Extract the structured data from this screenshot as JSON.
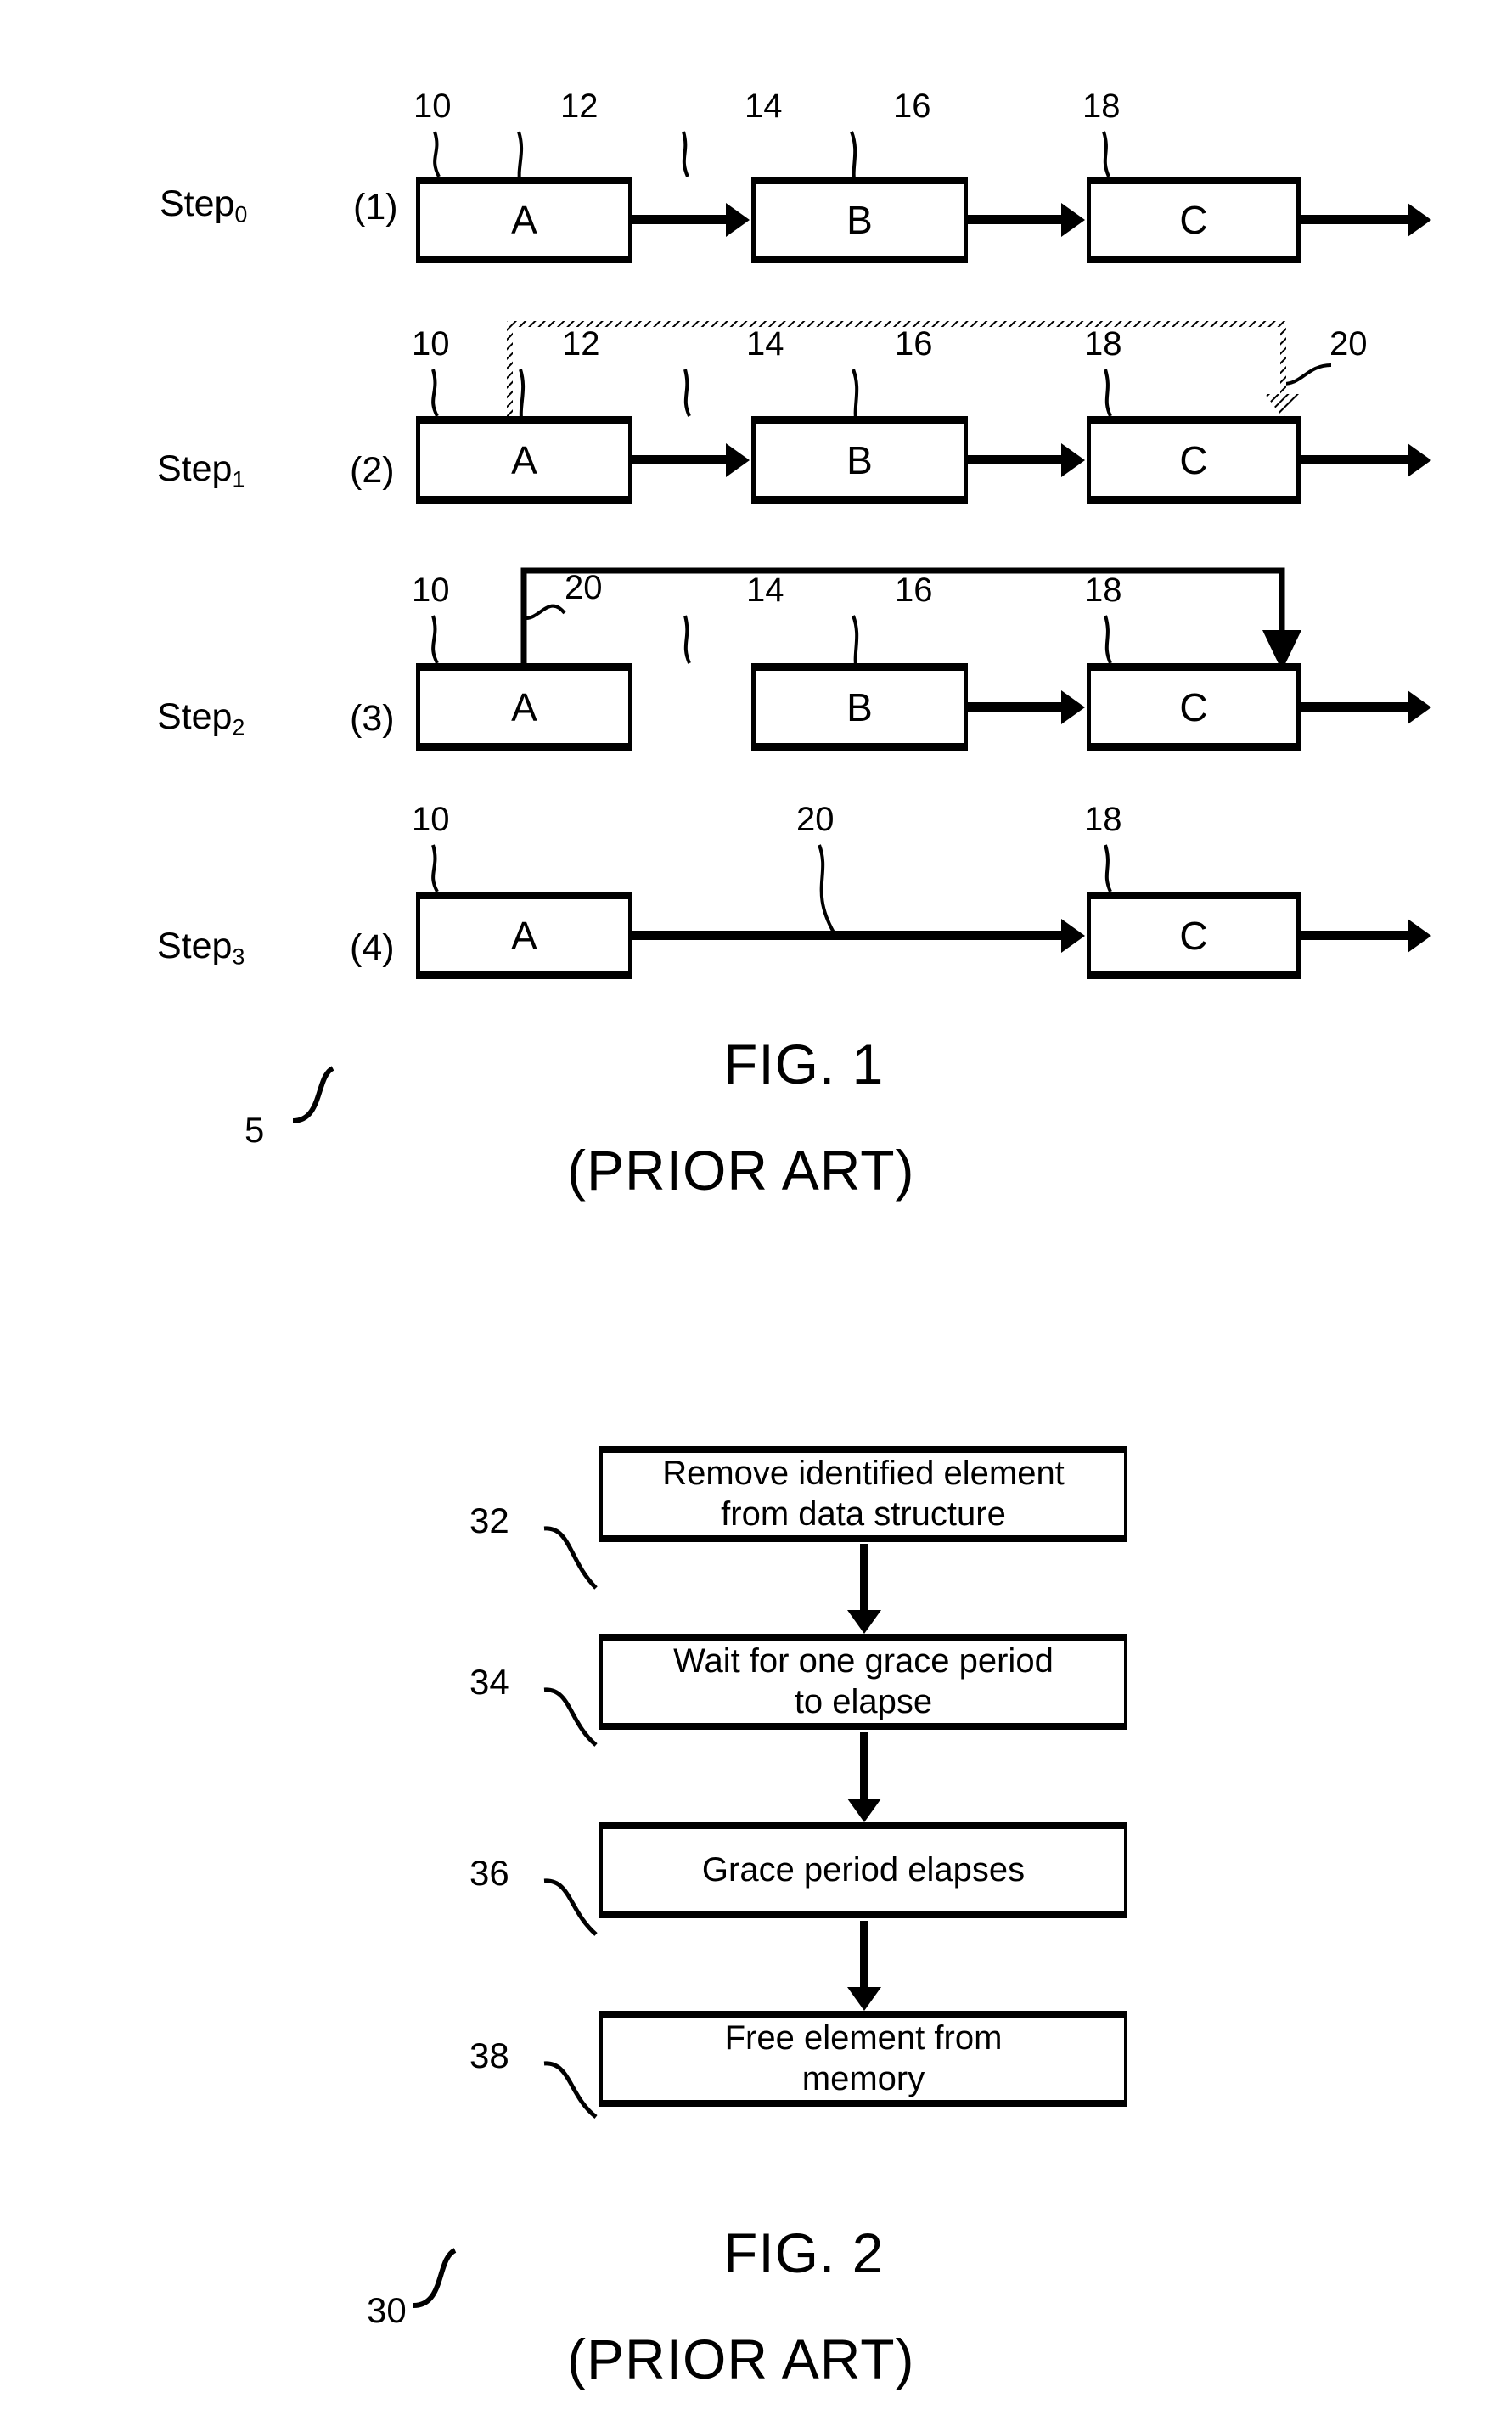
{
  "figure1": {
    "id_label": "5",
    "caption_line1": "FIG. 1",
    "caption_line2": "(PRIOR ART)",
    "node_labels": {
      "a": "A",
      "b": "B",
      "c": "C"
    },
    "rows": [
      {
        "step_label": "Step",
        "step_subscript": "0",
        "sequence": "(1)",
        "refs": [
          "10",
          "12",
          "14",
          "16",
          "18"
        ],
        "nodes": [
          "A",
          "B",
          "C"
        ]
      },
      {
        "step_label": "Step",
        "step_subscript": "1",
        "sequence": "(2)",
        "refs": [
          "10",
          "12",
          "14",
          "16",
          "18"
        ],
        "bypass_ref": "20",
        "nodes": [
          "A",
          "B",
          "C"
        ]
      },
      {
        "step_label": "Step",
        "step_subscript": "2",
        "sequence": "(3)",
        "refs": [
          "10",
          "14",
          "16",
          "18"
        ],
        "bypass_ref": "20",
        "nodes": [
          "A",
          "B",
          "C"
        ]
      },
      {
        "step_label": "Step",
        "step_subscript": "3",
        "sequence": "(4)",
        "refs": [
          "10",
          "18"
        ],
        "bypass_ref": "20",
        "nodes": [
          "A",
          "C"
        ]
      }
    ]
  },
  "figure2": {
    "id_label": "30",
    "caption_line1": "FIG. 2",
    "caption_line2": "(PRIOR ART)",
    "steps": [
      {
        "ref": "32",
        "line1": "Remove identified element",
        "line2": "from data structure"
      },
      {
        "ref": "34",
        "line1": "Wait for one grace period",
        "line2": "to elapse"
      },
      {
        "ref": "36",
        "line1": "Grace period elapses",
        "line2": ""
      },
      {
        "ref": "38",
        "line1": "Free element from",
        "line2": "memory"
      }
    ]
  }
}
